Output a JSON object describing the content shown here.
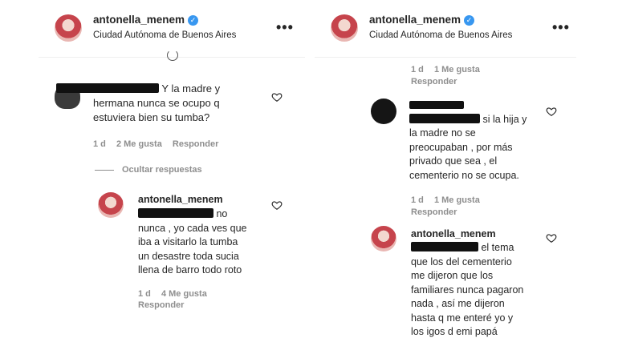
{
  "left": {
    "header": {
      "username": "antonella_menem",
      "location": "Ciudad Autónoma de Buenos Aires",
      "more": "•••"
    },
    "comment1": {
      "lines": [
        "Y la madre y",
        "hermana nunca se ocupo q",
        "estuviera bien su tumba?"
      ],
      "time": "1 d",
      "likes": "2 Me gusta",
      "reply": "Responder"
    },
    "hide_replies": "Ocultar respuestas",
    "reply1": {
      "username": "antonella_menem",
      "lines": [
        "no",
        "nunca , yo cada ves que",
        "iba a visitarlo la tumba",
        "un desastre toda sucia",
        "llena de barro todo roto"
      ],
      "time": "1 d",
      "likes": "4 Me gusta",
      "reply": "Responder"
    }
  },
  "right": {
    "header": {
      "username": "antonella_menem",
      "location": "Ciudad Autónoma de Buenos Aires",
      "more": "•••"
    },
    "top_meta": {
      "time": "1 d",
      "likes": "1 Me gusta",
      "reply": "Responder"
    },
    "comment2": {
      "lines": [
        "si la hija y",
        "la madre no se",
        "preocupaban , por más",
        "privado que sea , el",
        "cementerio no se ocupa."
      ],
      "time": "1 d",
      "likes": "1 Me gusta",
      "reply": "Responder"
    },
    "reply2": {
      "username": "antonella_menem",
      "lines": [
        "el tema",
        "que los del cementerio",
        "me dijeron que los",
        "familiares nunca pagaron",
        "nada , así me dijeron",
        "hasta q me enteré yo y",
        "los igos d emi papá"
      ]
    }
  }
}
